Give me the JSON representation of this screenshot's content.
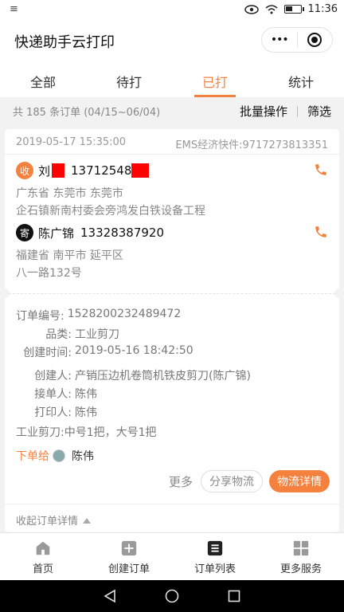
{
  "status_bar": {
    "left_text": "≡",
    "time": "11:36"
  },
  "app": {
    "title": "快递助手云打印",
    "more_label": "•••"
  },
  "tabs": [
    {
      "label": "全部"
    },
    {
      "label": "待打"
    },
    {
      "label": "已打",
      "active": true
    },
    {
      "label": "统计"
    }
  ],
  "summary": {
    "count_text": "共 185 条订单 (04/15~06/04)",
    "batch_label": "批量操作",
    "filter_label": "筛选"
  },
  "order": {
    "date": "2019-05-17 15:35:00",
    "carrier": "EMS经济快件:9717273813351",
    "receiver": {
      "badge": "收",
      "name": "刘",
      "phone": "13712548",
      "address_line1": "广东省 东莞市 东莞市",
      "address_line2": "企石镇新南村委会旁鸿发白铁设备工程"
    },
    "sender": {
      "badge": "寄",
      "name": "陈广锦",
      "phone": "13328387920",
      "address_line1": "福建省 南平市 延平区",
      "address_line2": "八一路132号"
    },
    "details": [
      {
        "key": "订单编号:",
        "value": "1528200232489472"
      },
      {
        "key": "品类:",
        "value": "工业剪刀"
      },
      {
        "key": "创建时间:",
        "value": "2019-05-16 18:42:50"
      },
      {
        "key": "创建人:",
        "value": "产销压边机卷筒机铁皮剪刀(陈广锦)"
      },
      {
        "key": "接单人:",
        "value": "陈伟"
      },
      {
        "key": "打印人:",
        "value": "陈伟"
      }
    ],
    "note": "工业剪刀:中号1把，大号1把",
    "assign_label": "下单给",
    "assign_name": "陈伟",
    "more_label": "更多",
    "share_label": "分享物流",
    "logistics_label": "物流详情",
    "collapse_label": "收起订单详情"
  },
  "bottom_nav": [
    {
      "label": "首页",
      "icon": "home-icon"
    },
    {
      "label": "创建订单",
      "icon": "plus-icon"
    },
    {
      "label": "订单列表",
      "icon": "list-icon"
    },
    {
      "label": "更多服务",
      "icon": "grid-icon"
    }
  ],
  "colors": {
    "accent": "#f5813f",
    "text": "#333333",
    "muted": "#888888"
  },
  "battery_level": 0.45
}
